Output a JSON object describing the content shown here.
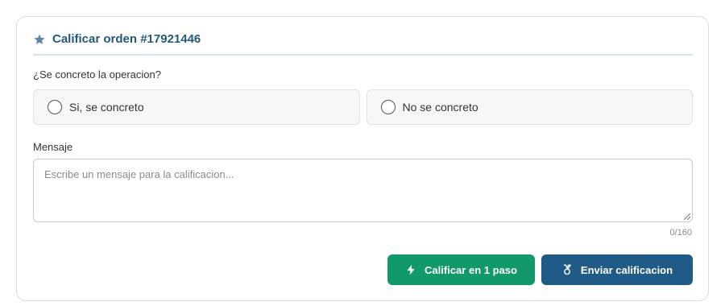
{
  "card": {
    "title": "Calificar orden #17921446",
    "title_icon": "star-icon",
    "accent_color": "#23587f"
  },
  "question": {
    "label": "¿Se concreto la operacion?",
    "options": [
      {
        "label": "Si, se concreto",
        "selected": false
      },
      {
        "label": "No se concreto",
        "selected": false
      }
    ]
  },
  "message": {
    "label": "Mensaje",
    "placeholder": "Escribe un mensaje para la calificacion...",
    "value": "",
    "counter": "0/160"
  },
  "actions": {
    "quick_rate": {
      "label": "Calificar en 1 paso",
      "icon": "lightning-icon",
      "color": "#12996a"
    },
    "submit": {
      "label": "Enviar calificacion",
      "icon": "medal-icon",
      "color": "#1f5b86"
    }
  }
}
